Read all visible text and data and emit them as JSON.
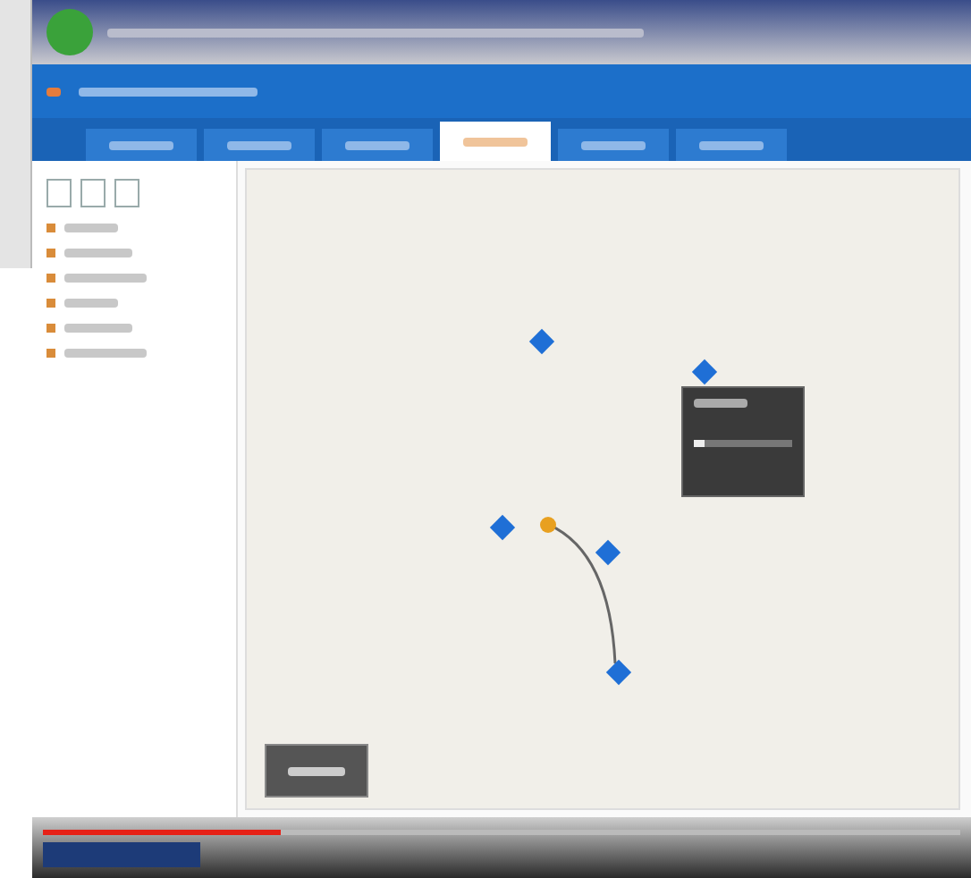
{
  "app": {
    "tabs": [
      {
        "selected": false
      },
      {
        "selected": false
      },
      {
        "selected": false
      },
      {
        "selected": true
      },
      {
        "selected": false
      },
      {
        "selected": false
      }
    ]
  },
  "map": {
    "markers": [
      {
        "kind": "pin"
      },
      {
        "kind": "pin"
      },
      {
        "kind": "pin"
      },
      {
        "kind": "origin"
      },
      {
        "kind": "pin"
      },
      {
        "kind": "pin"
      }
    ],
    "popup": {
      "level": 0.1
    }
  },
  "video": {
    "progress": {
      "level": 0.26
    }
  }
}
